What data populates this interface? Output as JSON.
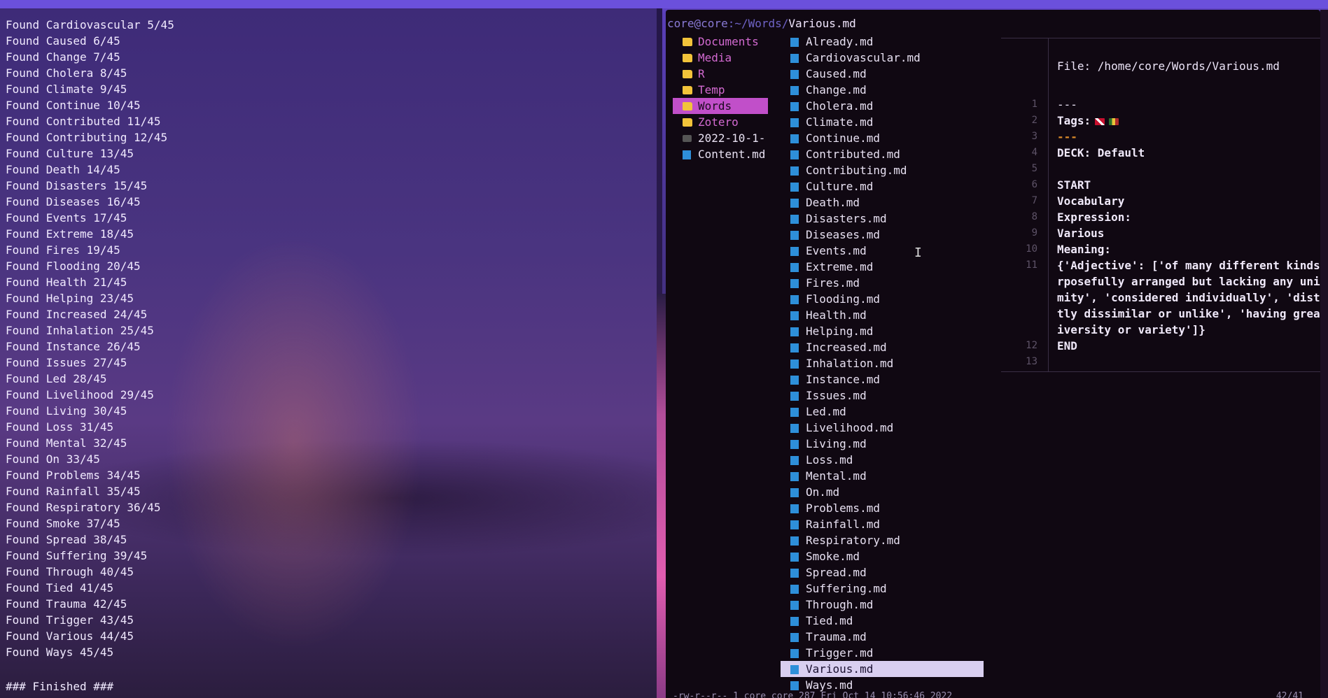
{
  "left_terminal": {
    "lines": [
      "Found Cardiovascular 5/45",
      "Found Caused 6/45",
      "Found Change 7/45",
      "Found Cholera 8/45",
      "Found Climate 9/45",
      "Found Continue 10/45",
      "Found Contributed 11/45",
      "Found Contributing 12/45",
      "Found Culture 13/45",
      "Found Death 14/45",
      "Found Disasters 15/45",
      "Found Diseases 16/45",
      "Found Events 17/45",
      "Found Extreme 18/45",
      "Found Fires 19/45",
      "Found Flooding 20/45",
      "Found Health 21/45",
      "Found Helping 23/45",
      "Found Increased 24/45",
      "Found Inhalation 25/45",
      "Found Instance 26/45",
      "Found Issues 27/45",
      "Found Led 28/45",
      "Found Livelihood 29/45",
      "Found Living 30/45",
      "Found Loss 31/45",
      "Found Mental 32/45",
      "Found On 33/45",
      "Found Problems 34/45",
      "Found Rainfall 35/45",
      "Found Respiratory 36/45",
      "Found Smoke 37/45",
      "Found Spread 38/45",
      "Found Suffering 39/45",
      "Found Through 40/45",
      "Found Tied 41/45",
      "Found Trauma 42/45",
      "Found Trigger 43/45",
      "Found Various 44/45",
      "Found Ways 45/45"
    ],
    "finished": "### Finished ###"
  },
  "file_manager": {
    "path_user": "core@core",
    "path_dir": ":~/Words/",
    "path_file": "Various.md",
    "parent_items": [
      {
        "name": "Documents",
        "type": "folder"
      },
      {
        "name": "Media",
        "type": "folder"
      },
      {
        "name": "R",
        "type": "folder"
      },
      {
        "name": "Temp",
        "type": "folder"
      },
      {
        "name": "Words",
        "type": "folder",
        "selected": true
      },
      {
        "name": "Zotero",
        "type": "folder"
      },
      {
        "name": "2022-10-1-",
        "type": "video"
      },
      {
        "name": "Content.md",
        "type": "file"
      }
    ],
    "files": [
      "Already.md",
      "Cardiovascular.md",
      "Caused.md",
      "Change.md",
      "Cholera.md",
      "Climate.md",
      "Continue.md",
      "Contributed.md",
      "Contributing.md",
      "Culture.md",
      "Death.md",
      "Disasters.md",
      "Diseases.md",
      "Events.md",
      "Extreme.md",
      "Fires.md",
      "Flooding.md",
      "Health.md",
      "Helping.md",
      "Increased.md",
      "Inhalation.md",
      "Instance.md",
      "Issues.md",
      "Led.md",
      "Livelihood.md",
      "Living.md",
      "Loss.md",
      "Mental.md",
      "On.md",
      "Problems.md",
      "Rainfall.md",
      "Respiratory.md",
      "Smoke.md",
      "Spread.md",
      "Suffering.md",
      "Through.md",
      "Tied.md",
      "Trauma.md",
      "Trigger.md",
      "Various.md",
      "Ways.md"
    ],
    "selected_file": "Various.md",
    "preview": {
      "file_label": "File: /home/core/Words/Various.md",
      "lines": [
        {
          "n": "1",
          "text": "---",
          "style": "dash"
        },
        {
          "n": "2",
          "text": "Tags:",
          "style": "bold",
          "flags": true
        },
        {
          "n": "3",
          "text": "---",
          "style": "orange"
        },
        {
          "n": "4",
          "text": "DECK: Default",
          "style": "bold"
        },
        {
          "n": "5",
          "text": "",
          "style": "bold"
        },
        {
          "n": "6",
          "text": "START",
          "style": "bold"
        },
        {
          "n": "7",
          "text": "Vocabulary",
          "style": "bold"
        },
        {
          "n": "8",
          "text": "Expression:",
          "style": "bold"
        },
        {
          "n": "9",
          "text": "Various",
          "style": "bold"
        },
        {
          "n": "10",
          "text": "Meaning:",
          "style": "bold"
        },
        {
          "n": "11",
          "text": "{'Adjective': ['of many different kinds p",
          "style": "bold"
        },
        {
          "n": "",
          "text": "rposefully arranged but lacking any unifo",
          "style": "bold"
        },
        {
          "n": "",
          "text": "mity', 'considered individually', 'distin",
          "style": "bold"
        },
        {
          "n": "",
          "text": "tly dissimilar or unlike', 'having great",
          "style": "bold"
        },
        {
          "n": "",
          "text": "iversity or variety']}",
          "style": "bold"
        },
        {
          "n": "12",
          "text": "END",
          "style": "bold"
        },
        {
          "n": "13",
          "text": "",
          "style": "bold"
        }
      ]
    },
    "status": "-rw-r--r-- 1 core core 287 Fri Oct 14 10:56:46 2022",
    "position": "42/41"
  }
}
